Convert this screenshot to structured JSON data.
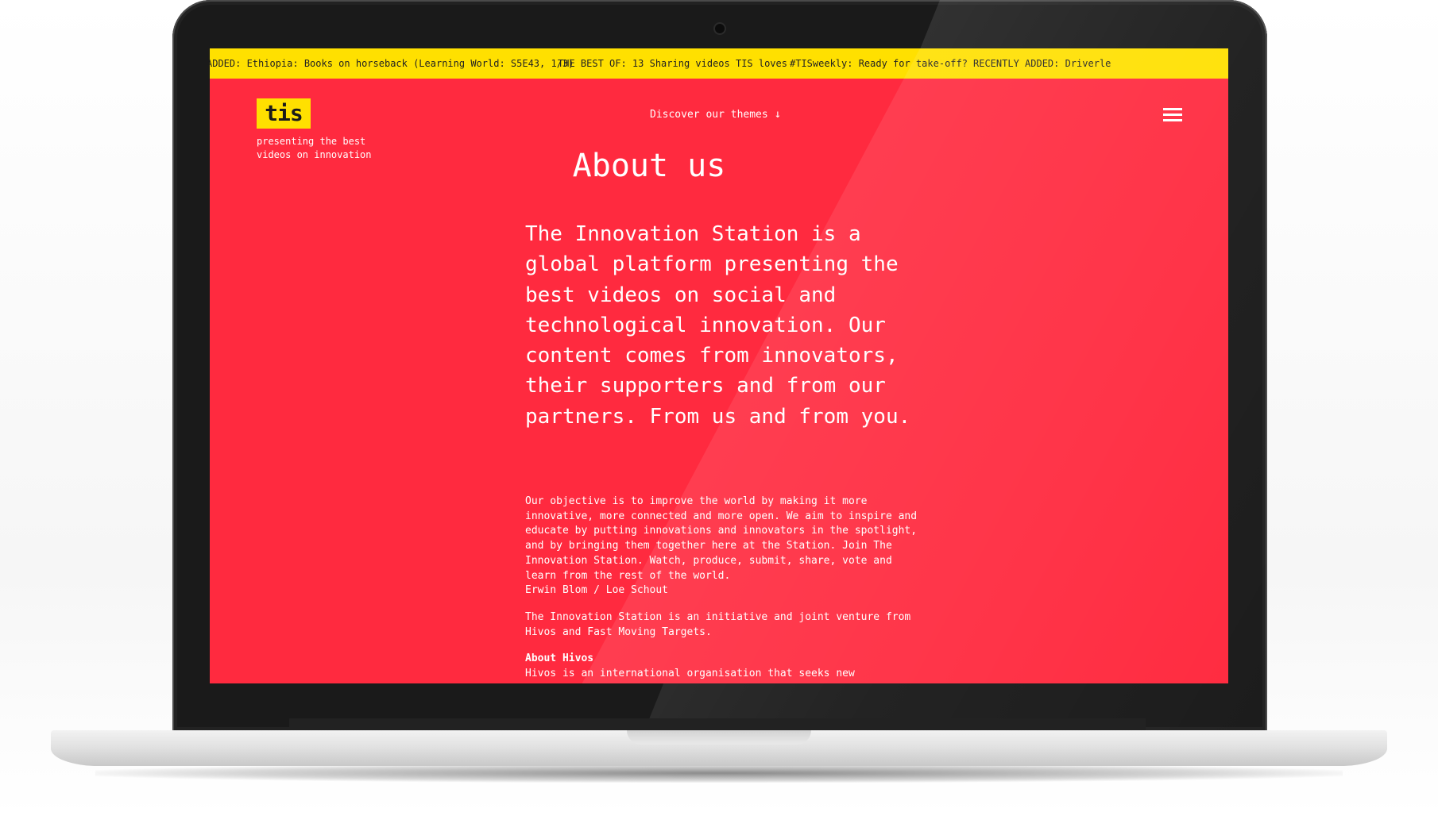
{
  "ticker": {
    "items": [
      "ADDED: Ethiopia: Books on horseback (Learning World: S5E43, 1/3)",
      "THE BEST OF: 13 Sharing videos TIS loves",
      "#TISweekly: Ready for take-off?",
      "RECENTLY ADDED: Driverle"
    ]
  },
  "header": {
    "logo_text": "tis",
    "tagline_line1": "presenting the best",
    "tagline_line2": "videos on innovation",
    "discover_label": "Discover our themes",
    "menu_icon": "hamburger-menu-icon"
  },
  "main": {
    "title": "About us",
    "lead": "The Innovation Station is a global platform presenting the best videos on social and technological innovation. Our content comes from innovators, their supporters and from our partners. From us and from you.",
    "paragraph1": "Our objective is to improve the world by making it more innovative, more connected and more open. We aim to inspire and educate by putting innovations and innovators in the spotlight, and by bringing them together here at the Station. Join The Innovation Station. Watch, produce, submit, share, vote and learn from the rest of the world.",
    "signature": "Erwin Blom / Loe Schout",
    "paragraph2": "The Innovation Station is an initiative and joint venture from Hivos and Fast Moving Targets.",
    "about_hivos_heading": "About Hivos",
    "about_hivos_text": "Hivos is an international organisation that seeks new"
  },
  "colors": {
    "background": "#ff2a3f",
    "ticker": "#ffe000",
    "text": "#ffffff"
  }
}
